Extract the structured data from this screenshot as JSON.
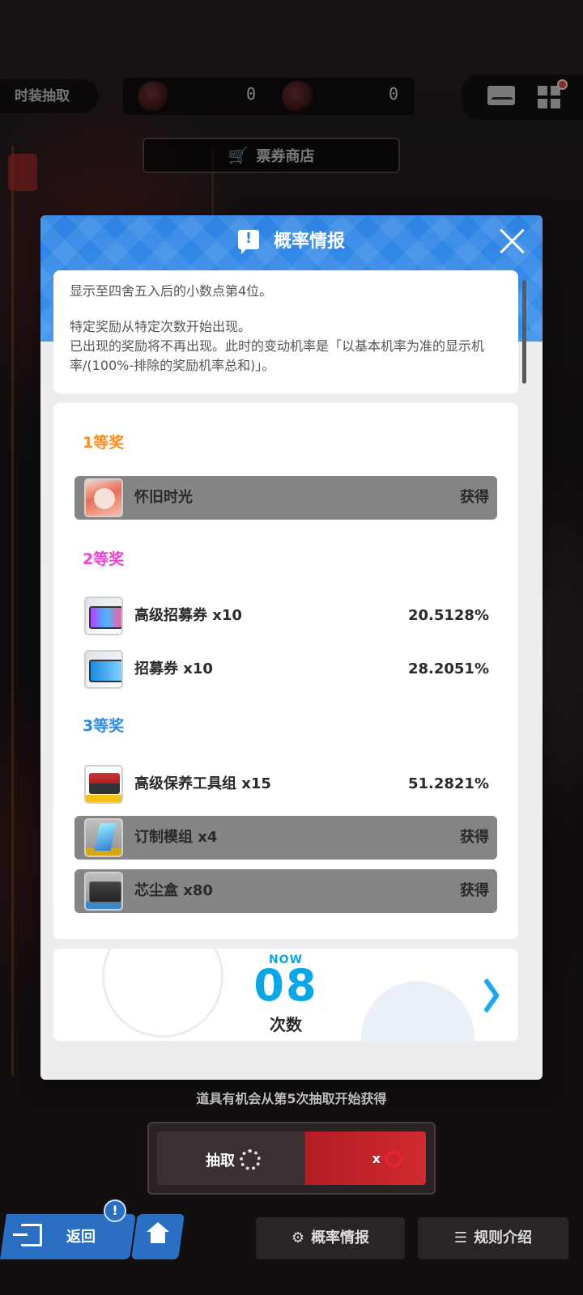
{
  "top": {
    "mode_label": "时装抽取",
    "currency": [
      {
        "icon": "ticket-token-icon",
        "value": "0"
      },
      {
        "icon": "ticket-token-icon",
        "value": "0"
      }
    ],
    "shop_label": "票券商店"
  },
  "modal": {
    "title": "概率情报",
    "notice": {
      "line1": "显示至四舍五入后的小数点第4位。",
      "line2": "特定奖励从特定次数开始出现。",
      "line3": "已出现的奖励将不再出现。此时的变动机率是「以基本机率为准的显示机率/(100%-排除的奖励机率总和)」。"
    },
    "tiers": [
      {
        "label": "1等奖",
        "color": "#ff8a1e",
        "items": [
          {
            "name": "怀旧时光",
            "status": "获得",
            "obtained": true
          }
        ]
      },
      {
        "label": "2等奖",
        "color": "#ee3ed5",
        "items": [
          {
            "name": "高级招募券 x10",
            "status": "20.5128%",
            "obtained": false
          },
          {
            "name": "招募券 x10",
            "status": "28.2051%",
            "obtained": false
          }
        ]
      },
      {
        "label": "3等奖",
        "color": "#2e8ae6",
        "items": [
          {
            "name": "高级保养工具组 x15",
            "status": "51.2821%",
            "obtained": false
          },
          {
            "name": "订制模组 x4",
            "status": "获得",
            "obtained": true
          },
          {
            "name": "芯尘盒 x80",
            "status": "获得",
            "obtained": true
          }
        ]
      }
    ],
    "counter": {
      "now_label": "NOW",
      "value": "08",
      "caption": "次数"
    }
  },
  "hint": "道具有机会从第5次抽取开始获得",
  "draw": {
    "label": "抽取",
    "cost": "x"
  },
  "nav": {
    "back_label": "返回",
    "alert": "!",
    "prob_label": "概率情报",
    "rules_label": "规则介绍"
  },
  "colors": {
    "accent_blue": "#2e83e3",
    "counter_cyan": "#0aa6e6",
    "obtained_gray": "#858585"
  }
}
